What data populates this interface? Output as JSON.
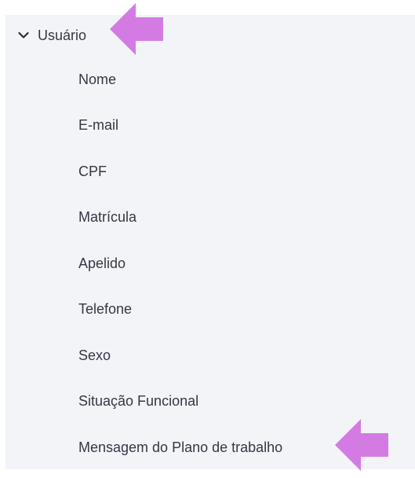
{
  "group": {
    "label": "Usuário",
    "expanded_icon": "chevron-down-icon"
  },
  "items": [
    {
      "label": "Nome"
    },
    {
      "label": "E-mail"
    },
    {
      "label": "CPF"
    },
    {
      "label": "Matrícula"
    },
    {
      "label": "Apelido"
    },
    {
      "label": "Telefone"
    },
    {
      "label": "Sexo"
    },
    {
      "label": "Situação Funcional"
    },
    {
      "label": "Mensagem do Plano de trabalho"
    }
  ],
  "annotations": {
    "arrow_color": "#d47be3",
    "arrow_icon": "left-arrow-icon"
  },
  "colors": {
    "panel_background": "#f3f4f8",
    "text": "#333844"
  }
}
